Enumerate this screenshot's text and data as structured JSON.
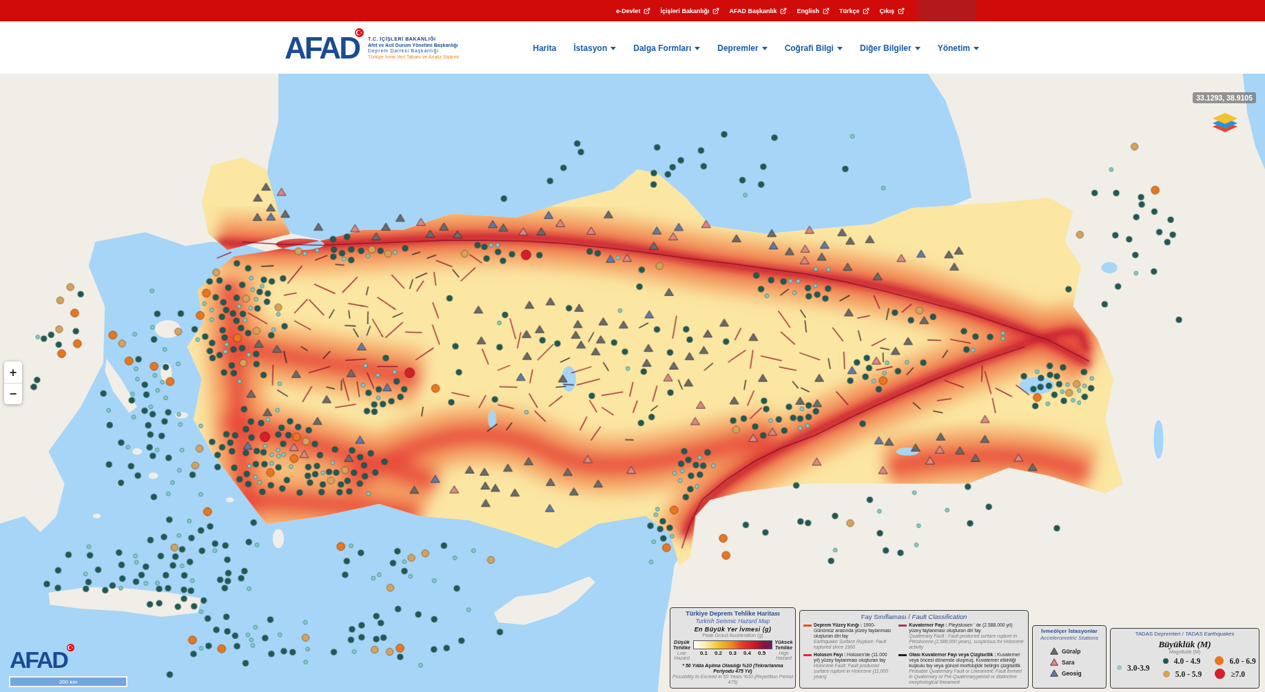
{
  "top_bar": {
    "links": [
      {
        "label": "e-Devlet"
      },
      {
        "label": "İçişleri Bakanlığı"
      },
      {
        "label": "AFAD Başkanlık"
      },
      {
        "label": "English"
      },
      {
        "label": "Türkçe"
      },
      {
        "label": "Çıkış"
      }
    ]
  },
  "header": {
    "logo": {
      "wordmark": "AFAD",
      "lines": [
        "T.C. İÇİŞLERİ BAKANLIĞI",
        "Afet ve Acil Durum Yönetimi Başkanlığı",
        "Deprem Dairesi Başkanlığı",
        "Türkiye İvme Veri Tabanı ve Analiz Sistemi"
      ]
    },
    "nav": [
      {
        "label": "Harita",
        "dropdown": false
      },
      {
        "label": "İstasyon",
        "dropdown": true
      },
      {
        "label": "Dalga Formları",
        "dropdown": true
      },
      {
        "label": "Depremler",
        "dropdown": true
      },
      {
        "label": "Coğrafi Bilgi",
        "dropdown": true
      },
      {
        "label": "Diğer Bilgiler",
        "dropdown": true
      },
      {
        "label": "Yönetim",
        "dropdown": true
      }
    ]
  },
  "map": {
    "coordinates": "33.1293, 38.9105",
    "zoom_in": "+",
    "zoom_out": "−",
    "logo": "AFAD",
    "scale": "200 km",
    "hazard_legend": {
      "title": "Türkiye Deprem Tehlike Haritası",
      "subtitle": "Turkish Seismic Hazard Map",
      "scale_title": "En Büyük Yer İvmesi (g)",
      "scale_subtitle": "Peak Groud Acceleration (g)",
      "low": "Düşük Tehlike",
      "low_en": "Low Hazard",
      "high": "Yüksek Tehlike",
      "high_en": "High Hazard",
      "ticks": [
        "0.1",
        "0.2",
        "0.3",
        "0.4",
        "0.5"
      ],
      "note": "* 50 Yılda Aşılma Olasılığı %10 (Tekrarlanma Periyodu 475 Yıl)",
      "note_en": "Possibility to Exceed in 50 Years %10 (Repetition Period 475)"
    },
    "fault_legend": {
      "title": "Fay Sınıflaması / *Fault Classification*",
      "items": [
        {
          "text": "**Deprem Yüzey Kırığı :** 1900-Günümüz arasında yüzey faylanması oluşturan diri fay",
          "text_en": "Earthquake Surface Rupture: Fault ruptured since 1900",
          "color": "#e8501a"
        },
        {
          "text": "**Holosen Fayı :** Holosen'de (11.000 yıl) yüzey faylanması oluşturan fay",
          "text_en": "Holocene Fault: Fault produced surface rupture in Holocene (11,000 years)",
          "color": "#e02a3a"
        },
        {
          "text": "**Kuvaterner Fayı :** Pleyistosen ' de (2.588.000 yıl) yüzey faylanması oluşturan diri fay",
          "text_en": "Quaternary Fault : Fault produced surface rupture in Pleistocene (2,588,000 years), suspicious for Holocene activity",
          "color": "#a3385e"
        },
        {
          "text": "**Olası Kuvaterner Fayı veya Çizgisellik :** Kuvaterner veya öncesi dönemde oluşmuş, Kuvaterner etkinliği kuşkulu fay veya güncel morfolojide belirgin çizgisellik",
          "text_en": "Probable Quaternary Fault or Lineament: Fault formed in Quaternary or Pre-Quaternaryperiod or distinctive morphological lineament",
          "color": "#1e1e1e"
        }
      ]
    },
    "station_legend": {
      "title": "İvmeölçer İstasyonlar",
      "subtitle": "Accelerometric Stations",
      "items": [
        {
          "label": "Güralp",
          "color": "#6b6b6b"
        },
        {
          "label": "Sara",
          "color": "#e38585"
        },
        {
          "label": "Geosig",
          "color": "#5f7bae"
        }
      ]
    },
    "earthquake_legend": {
      "title": "TADAS Depremleri / *TADAS Earthquakes*",
      "scale_title": "Büyüklük (M)",
      "scale_subtitle": "Magnitude (M)",
      "items": [
        {
          "label": "3.0-3.9",
          "color": "#86d0c8"
        },
        {
          "label": "4.0 - 4.9",
          "color": "#1f5a55"
        },
        {
          "label": "5.0 - 5.9",
          "color": "#d6a25c"
        },
        {
          "label": "6.0 - 6.9",
          "color": "#e8761e"
        },
        {
          "label": "≥7.0",
          "color": "#d4202a"
        }
      ]
    }
  }
}
